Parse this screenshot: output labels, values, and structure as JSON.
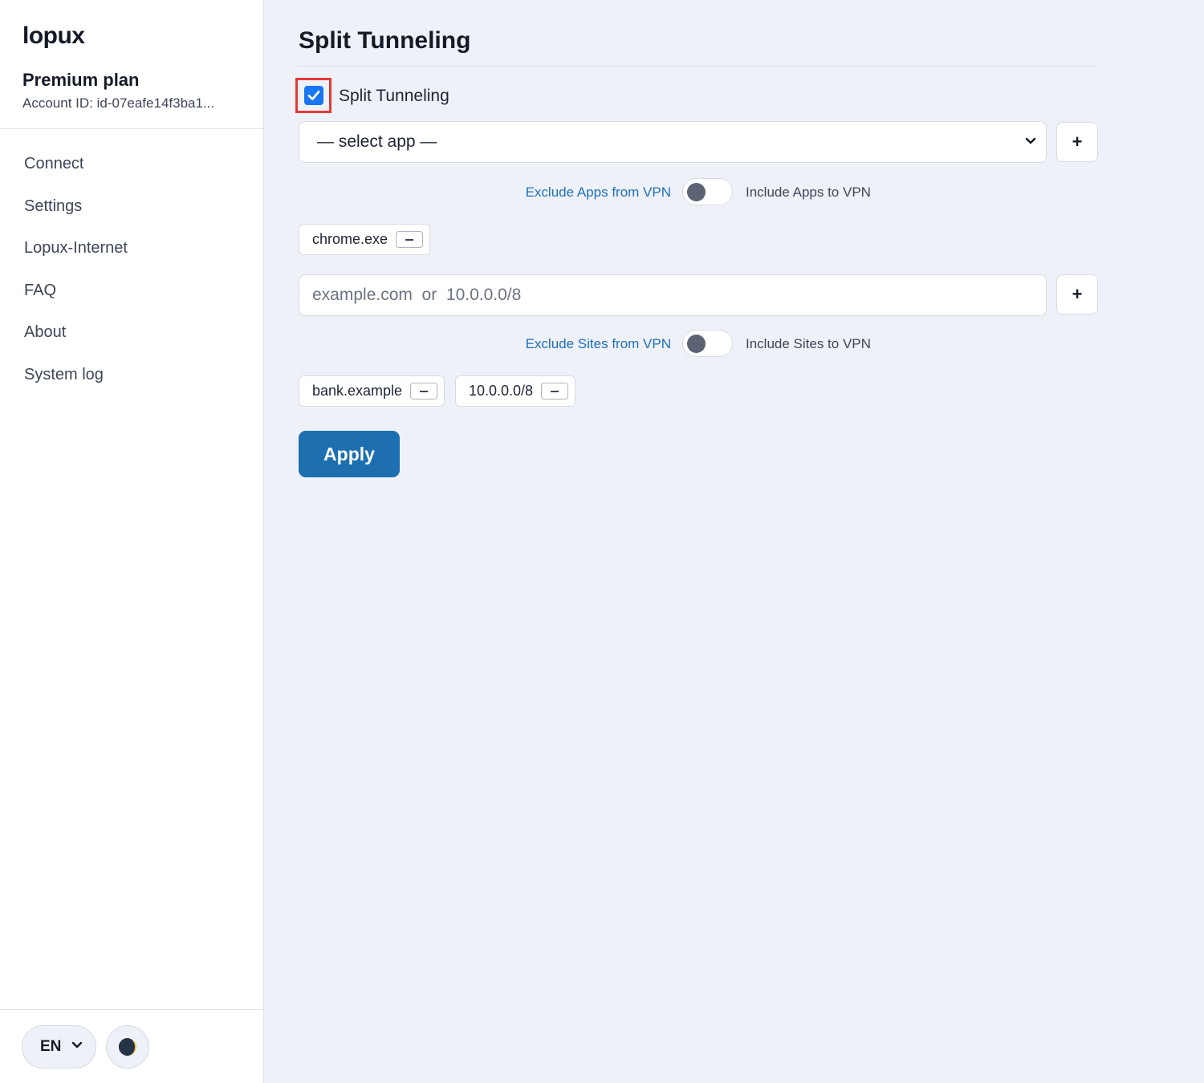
{
  "sidebar": {
    "brand": "lopux",
    "plan": "Premium plan",
    "account_id": "Account ID: id-07eafe14f3ba1...",
    "nav": [
      "Connect",
      "Settings",
      "Lopux-Internet",
      "FAQ",
      "About",
      "System log"
    ],
    "language": "EN"
  },
  "main": {
    "title": "Split Tunneling",
    "split_checkbox": {
      "label": "Split Tunneling",
      "checked": true
    },
    "app_select": {
      "value": "— select app —"
    },
    "add_label": "+",
    "apps_toggle": {
      "left_label": "Exclude Apps from VPN",
      "right_label": "Include Apps to VPN",
      "on": false
    },
    "apps": [
      "chrome.exe"
    ],
    "site_input": {
      "placeholder": "example.com  or  10.0.0.0/8",
      "value": ""
    },
    "sites_toggle": {
      "left_label": "Exclude Sites from VPN",
      "right_label": "Include Sites to VPN",
      "on": false
    },
    "sites": [
      "bank.example",
      "10.0.0.0/8"
    ],
    "apply_label": "Apply"
  },
  "colors": {
    "accent": "#1d6fb0",
    "checkbox": "#1976f0",
    "highlight_border": "#e53935",
    "link_blue": "#1f6fb8",
    "background": "#eef1f8"
  }
}
